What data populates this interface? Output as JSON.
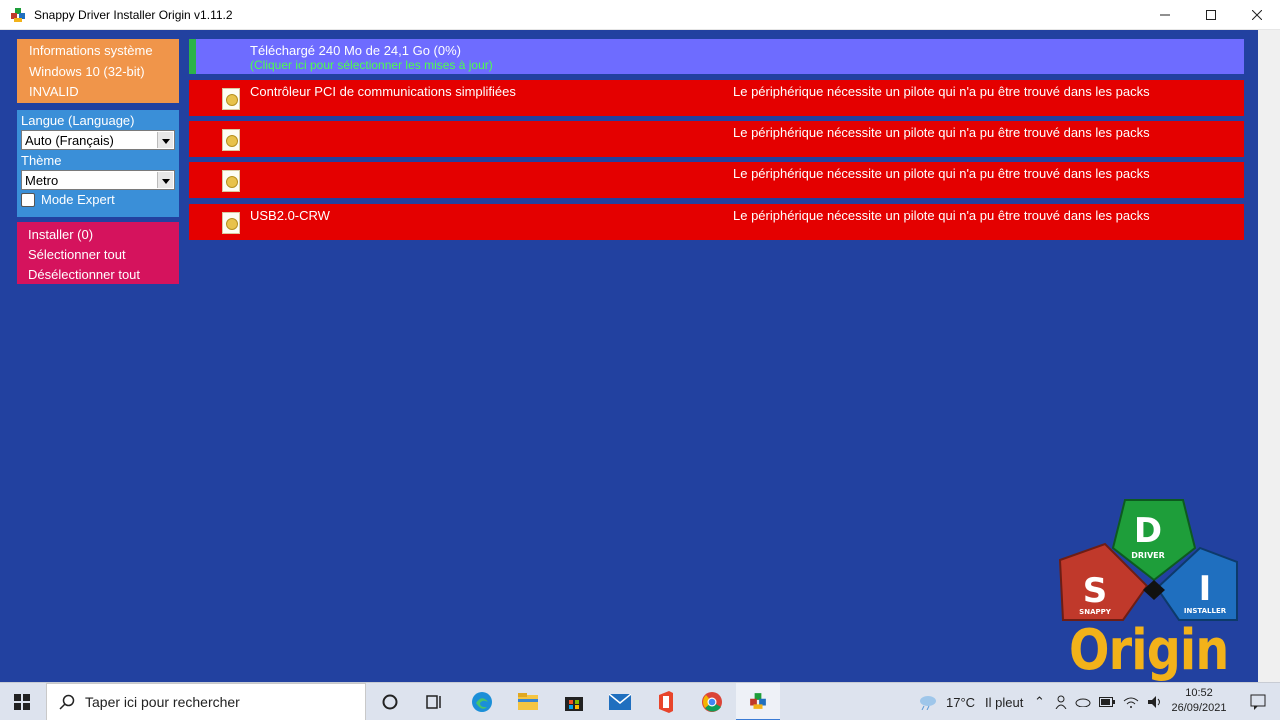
{
  "window": {
    "title": "Snappy Driver Installer Origin v1.11.2"
  },
  "sidebar": {
    "info": [
      "Informations système",
      "Windows 10 (32-bit)",
      "INVALID"
    ],
    "language_label": "Langue (Language)",
    "language_value": "Auto (Français)",
    "theme_label": "Thème",
    "theme_value": "Metro",
    "expert_mode_label": "Mode Expert",
    "actions": [
      "Installer (0)",
      "Sélectionner tout",
      "Désélectionner tout"
    ]
  },
  "update": {
    "downloaded": "Téléchargé 240 Mo de 24,1 Go (0%)",
    "hint": "(Cliquer ici pour sélectionner les mises à jour)"
  },
  "devices": [
    {
      "name": "Contrôleur PCI de communications simplifiées",
      "status": "Le périphérique nécessite un pilote qui n'a pu être trouvé dans les packs"
    },
    {
      "name": "",
      "status": "Le périphérique nécessite un pilote qui n'a pu être trouvé dans les packs"
    },
    {
      "name": "",
      "status": "Le périphérique nécessite un pilote qui n'a pu être trouvé dans les packs"
    },
    {
      "name": "USB2.0-CRW",
      "status": "Le périphérique nécessite un pilote qui n'a pu être trouvé dans les packs"
    }
  ],
  "logo": {
    "letters": [
      "D",
      "S",
      "I"
    ],
    "words": [
      "DRIVER",
      "SNAPPY",
      "INSTALLER"
    ],
    "origin": "Origin"
  },
  "taskbar": {
    "search_placeholder": "Taper ici pour rechercher",
    "weather_temp": "17°C",
    "weather_text": "Il pleut",
    "time": "10:52",
    "date": "26/09/2021"
  },
  "colors": {
    "background": "#2241a0",
    "info_panel": "#f0954a",
    "settings_panel": "#3a8fd8",
    "actions_panel": "#d5135d",
    "update_row": "#6e6cff",
    "device_row": "#e40000"
  }
}
